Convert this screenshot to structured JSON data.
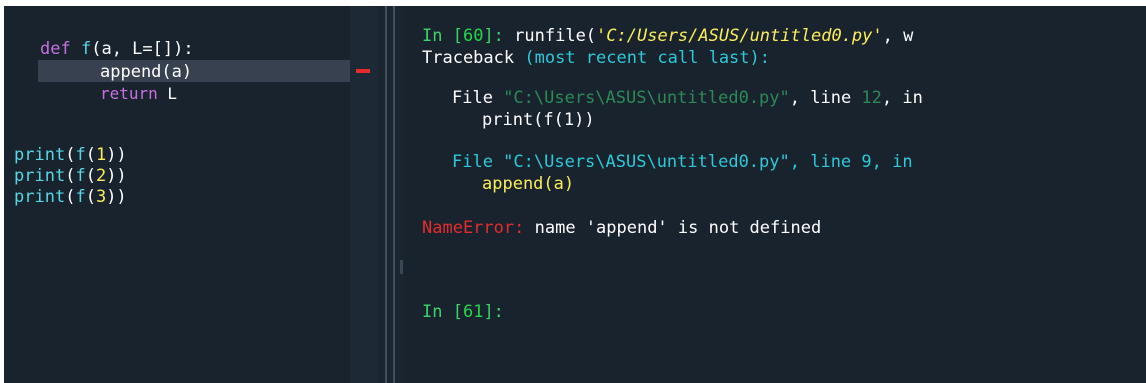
{
  "editor": {
    "line1": {
      "def": "def",
      "name": "f",
      "open": "(a, L=[]):"
    },
    "line2": {
      "call": "append",
      "arg": "(a)"
    },
    "line3": {
      "kw": "return",
      "val": " L"
    },
    "calls": [
      {
        "fn": "print",
        "p1": "(",
        "inner": "f",
        "p2": "(",
        "num": "1",
        "p3": "))"
      },
      {
        "fn": "print",
        "p1": "(",
        "inner": "f",
        "p2": "(",
        "num": "2",
        "p3": "))"
      },
      {
        "fn": "print",
        "p1": "(",
        "inner": "f",
        "p2": "(",
        "num": "3",
        "p3": "))"
      }
    ]
  },
  "console": {
    "in60": {
      "label": "In [",
      "num": "60",
      "close": "]: ",
      "cmd": "runfile(",
      "arg": "'C:/Users/ASUS/untitled0.py'",
      "rest": ", w"
    },
    "traceback": {
      "word": "Traceback ",
      "paren": "(most recent call last):"
    },
    "frame1": {
      "file": "File ",
      "path": "\"C:\\Users\\ASUS\\untitled0.py\"",
      "comma": ", line ",
      "lineno": "12",
      "tail": ", in"
    },
    "frame1_code": "print(f(1))",
    "frame2": {
      "text": "File \"C:\\Users\\ASUS\\untitled0.py\", line 9, in"
    },
    "frame2_code": "append(a)",
    "error": {
      "name": "NameError",
      "colon": ": ",
      "msg": "name 'append' is not defined"
    },
    "in61": {
      "label": "In [",
      "num": "61",
      "close": "]:"
    }
  },
  "colors": {
    "background": "#19232d",
    "error": "#e52b2b",
    "prompt": "#3cd46b",
    "keyword": "#c670e0",
    "function": "#57d6e4",
    "number": "#faed5c"
  }
}
